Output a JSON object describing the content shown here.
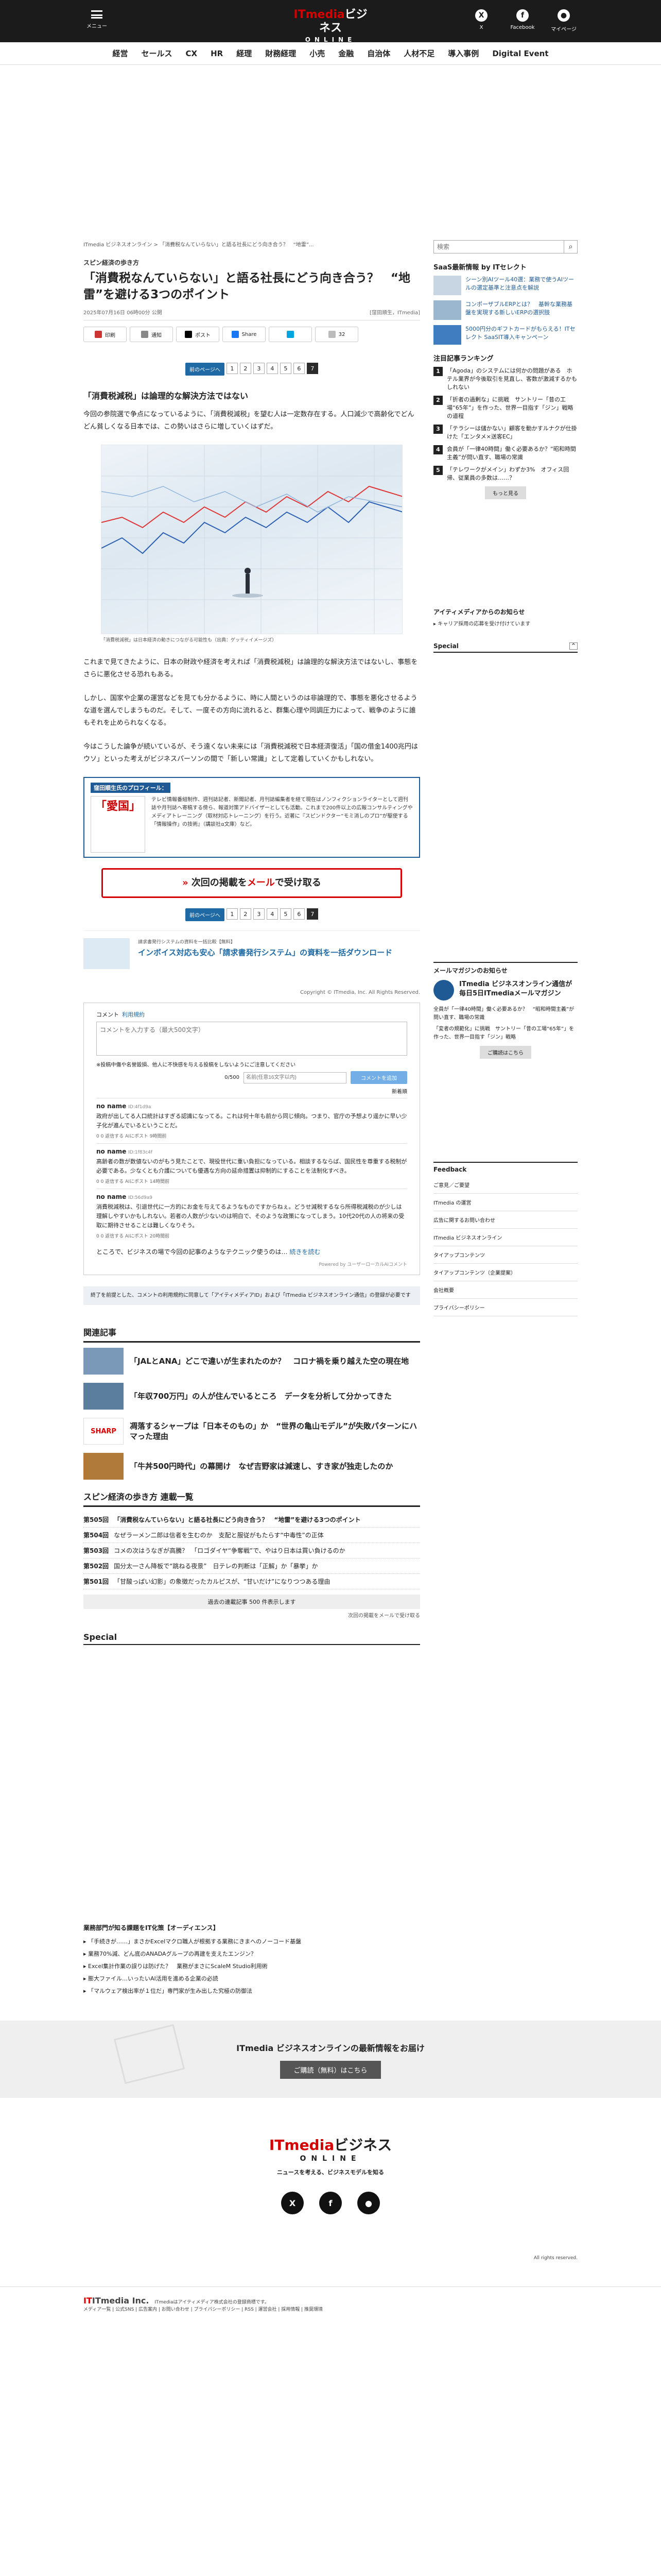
{
  "header": {
    "menu_label": "メニュー",
    "logo_text": "ビジネス",
    "logo_brand": "ITmedia",
    "logo_sub": "ONLINE",
    "x_label": "X",
    "facebook_label": "Facebook",
    "mypage_label": "マイページ"
  },
  "nav": [
    "経営",
    "セールス",
    "CX",
    "HR",
    "経理",
    "財務経理",
    "小売",
    "金融",
    "自治体",
    "人材不足",
    "導入事例",
    "Digital Event"
  ],
  "breadcrumb": "ITmedia ビジネスオンライン  > 「消費税なんていらない」と語る社長にどう向き合う？　“地雷”...",
  "article": {
    "series": "スピン経済の歩き方",
    "title": "「消費税なんていらない」と語る社長にどう向き合う？　“地雷”を避ける3つのポイント",
    "date": "2025年07月16日 06時00分 公開",
    "author": "[窪田順生，ITmedia]",
    "share": [
      "印刷",
      "通知",
      "ポスト",
      "Share",
      "32"
    ],
    "pager_prev": "前のページへ",
    "pages": [
      "1",
      "2",
      "3",
      "4",
      "5",
      "6",
      "7"
    ],
    "current_page": "7",
    "h2": "「消費税減税」は論理的な解決方法ではない",
    "p1": "今回の参院選で争点になっているように、「消費税減税」を望む人は一定数存在する。人口減少で高齢化でどんどん貧しくなる日本では、この勢いはさらに増していくはずだ。",
    "caption": "「消費税減税」は日本経済の動きにつながる可能性も（出典：ゲッティイメージズ）",
    "p2": "これまで見てきたように、日本の財政や経済を考えれば「消費税減税」は論理的な解決方法ではないし、事態をさらに悪化させる恐れもある。",
    "p3": "しかし、国家や企業の運営などを見ても分かるように、時に人間というのは非論理的で、事態を悪化させるような道を選んでしまうものだ。そして、一度その方向に流れると、群集心理や同調圧力によって、戦争のように誰もそれを止められなくなる。",
    "p4": "今はこうした論争が続いているが、そう遠くない未来には「消費税減税で日本経済復活」「国の借金1400兆円はウソ」といった考えがビジネスパーソンの間で「新しい常識」として定着していくかもしれない。",
    "profile_title": "窪田順生氏のプロフィール：",
    "profile_book": "「愛国」",
    "profile_desc": "テレビ情報番組制作、週刊誌記者、新聞記者、月刊誌編集者を経て現在はノンフィクションライターとして週刊誌や月刊誌へ寄稿する傍ら、報道対策アドバイザーとしても活動。これまで200件以上の広報コンサルティングやメディアトレーニング（取材対応トレーニング）を行う。近著に『スピンドクター“モミ消しのプロ”が駆使する「情報操作」の技術』（講談社α文庫）など。",
    "next_label_a": "次回の掲載を",
    "next_label_b": "メール",
    "next_label_c": "で受け取る",
    "promo_src": "請求書発行システムの資料を一括比較【無料】",
    "promo_title": "インボイス対応も安心「請求書発行システム」の資料を一括ダウンロード",
    "copyright": "Copyright © ITmedia, Inc. All Rights Reserved."
  },
  "comments": {
    "head": "コメント",
    "rule_link": "利用規約",
    "placeholder": "コメントを入力する（最大500文字）",
    "note": "※投稿中傷や名誉毀損、他人に不快感を与える投稿をしないようにご注意してください",
    "count": "0/500",
    "name_placeholder": "名前(任意16文字以内)",
    "submit": "コメントを追加",
    "sort": "新着順",
    "items": [
      {
        "name": "no name",
        "id": "ID:4f1d9a",
        "body": "政府が出してる人口統計はすぎる認識になってる。これは何十年も前から同じ傾向。つまり、官庁の予想より遥かに早い少子化が進んでいるということだ。",
        "stat": "0  0  返信する  AIにポスト  9時間前"
      },
      {
        "name": "no name",
        "id": "ID:1f83c4f",
        "body": "高齢者の数が数値ないのがもう見たことで、現役世代に重い負担になっている。相談するならば、国民性を尊重する税制が必要である。少なくとも介護についても優遇な方向の延命措置は抑制的にすることを法制化すべき。",
        "stat": "0  0  返信する  AIにポスト  14時間前"
      },
      {
        "name": "no name",
        "id": "ID:56d9a9",
        "body": "消費税減税は、引退世代に一方的にお金を与えてるようなものですからねぇ。どうせ減税するなら所得税減税のが少しは理解しやすいかもしれない。若者の人数が少ないのは明白で、そのような政策になってしまう。10代20代の人の将来の受取に期待させることは難しくなりそう。",
        "stat": "0  0  返信する  AIにポスト  20時間前"
      }
    ],
    "end": "ところで、ビジネスの場で今回の記事のようなテクニック使うのは…",
    "more": "続きを読む",
    "powered": "Powered by ユーザーローカルAIコメント"
  },
  "gray_note": "終了を前提とした、コメントの利用規約に同意して「アイティメディアID」および「ITmedia ビジネスオンライン通信」の登録が必要です",
  "related": {
    "title": "関連記事",
    "items": [
      "「JALとANA」どこで違いが生まれたのか？　コロナ禍を乗り越えた空の現在地",
      "「年収700万円」の人が住んでいるところ　データを分析して分かってきた",
      "凋落するシャープは「日本そのもの」か　“世界の亀山モデル”が失敗パターンにハマった理由",
      "「牛丼500円時代」の幕開け　なぜ吉野家は減速し、すき家が独走したのか"
    ]
  },
  "series_list": {
    "title": "スピン経済の歩き方 連載一覧",
    "items": [
      {
        "n": "第505回",
        "t": "「消費税なんていらない」と語る社長にどう向き合う？　“地雷”を避ける3つのポイント"
      },
      {
        "n": "第504回",
        "t": "なぜラーメン二郎は信者を生むのか　支配と服従がもたらす“中毒性”の正体"
      },
      {
        "n": "第503回",
        "t": "コメの次はうなぎが高騰？　「ロゴダイヤ“争奪戦”で、やはり日本は買い負けるのか"
      },
      {
        "n": "第502回",
        "t": "国分太一さん降板で“跳ねる夜景”　日テレの判断は「正解」か「暴挙」か"
      },
      {
        "n": "第501回",
        "t": "「甘酸っぱい幻影」の象徴だったカルピスが、“甘いだけ”になりつつある理由"
      }
    ],
    "more": "過去の連載記事 500 件表示します",
    "mail": "次回の掲載をメールで受け取る"
  },
  "special_title": "Special",
  "sidebar": {
    "search_placeholder": "検索",
    "saas_title": "SaaS最新情報 by ITセレクト",
    "saas": [
      "シーン別AIツール40選：業務で使うAIツールの選定基準と注意点を解説",
      "コンポーザブルERPとは？　基幹な業務基盤を実現する新しいERPの選択肢",
      "5000円分のギフトカードがもらえる！ITセレクト SaaSIT導入キャンペーン"
    ],
    "rank_title": "注目記事ランキング",
    "ranking": [
      "「Agoda」のシステムには何かの問題がある　ホテル業界が今後取引を見直し、客数が激減するかもしれない",
      "「折者の過剰な」に挑戦　サントリー「昔の工場“65年”」を作った、世界一目指す「ジン」戦略の道程",
      "「テラシーは儲かない」顧客を動かすルナクが仕掛けた「エンタメ×送客EC」",
      "会員が「一律40時間」働く必要あるか？“昭和時間主義”が問い直す、職場の常識",
      "「テレワークがメイン」わずか3%　オフィス回帰、従業員の多数は……？"
    ],
    "more": "もっと見る",
    "ai_title": "アイティメディアからのお知らせ",
    "ai_item": "キャリア採用の応募を受け付けています",
    "special": "Special",
    "mail_title": "メールマガジンのお知らせ",
    "mail_head": "ITmedia ビジネスオンライン通信が毎日5日ITmediaメールマガジン",
    "mail_items": [
      "全員が「一律40時間」働く必要あるか？　“昭和時間主義”が問い直す、職場の常識",
      "「変者の規範化」に挑戦　サントリー「昔の工場“65年”」を作った、世界一目指す「ジン」戦略"
    ],
    "mail_btn": "ご購読はこちら",
    "fb_title": "Feedback",
    "fb_items": [
      "ご意見／ご要望",
      "ITmedia の運営",
      "広告に関するお問い合わせ",
      "ITmedia ビジネスオンライン",
      "タイアップコンテンツ",
      "タイアップコンテンツ（企業提案）",
      "会社概要",
      "プライバシーポリシー"
    ]
  },
  "picks": {
    "title": "業務部門が知る課題をIT化策【オーディエンス】",
    "items": [
      "「手続きが……」まさかExcelマクロ職人が根拠する業務にきまへのノーコード基盤",
      "業務70%減、どん底のANADAグループの再建を支えたエンジン？",
      "Excel集計作業の誤りは防げた？　業務がまさにScaleM Studio利用術",
      "膨大ファイル…いったいAI活用を進める企業の必読",
      "「マルウェア検出率が１位だ」専門家が生み出した究極の防御法"
    ]
  },
  "newsletter": {
    "text": "ITmedia ビジネスオンラインの最新情報をお届け",
    "btn": "ご購読（無料）はこちら"
  },
  "footer_logo": {
    "brand": "ITmedia",
    "text": "ビジネス",
    "sub": "ONLINE",
    "tagline": "ニュースを考える、ビジネスモデルを知る"
  },
  "rights": "All rights reserved.",
  "corp": {
    "name": "ITmedia Inc.",
    "text": "ITmediaはアイティメディア株式会社の登録商標です。",
    "links": "メディア一覧 | 公式SNS | 広告案内 | お問い合わせ | プライバシーポリシー | RSS | 運営会社 | 採用情報 | 推奨環境"
  }
}
